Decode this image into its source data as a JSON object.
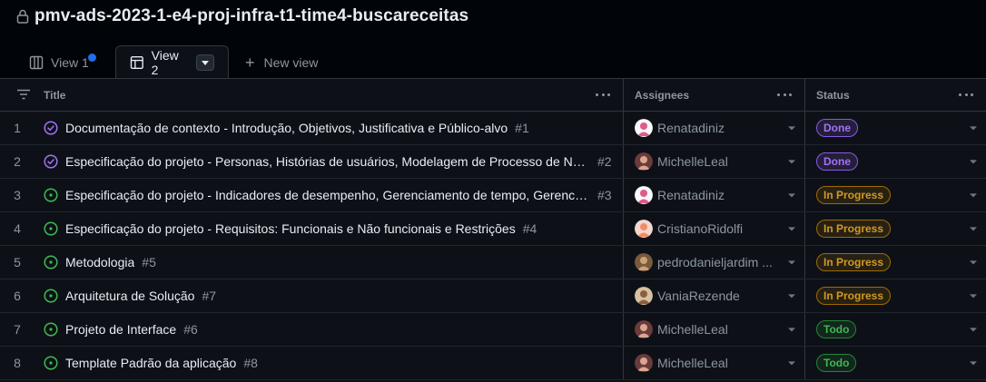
{
  "project": {
    "title": "pmv-ads-2023-1-e4-proj-infra-t1-time4-buscareceitas"
  },
  "tabs": [
    {
      "label": "View 1"
    },
    {
      "label": "View 2"
    },
    {
      "label": "New view"
    }
  ],
  "columns": {
    "title": "Title",
    "assignees": "Assignees",
    "status": "Status"
  },
  "colors": {
    "done": "#a371f7",
    "in_progress": "#d29922",
    "todo": "#3fb950",
    "unread_dot": "#1f6feb"
  },
  "rows": [
    {
      "index": "1",
      "title": "Documentação de contexto - Introdução, Objetivos, Justificativa e Público-alvo",
      "issue": "#1",
      "state_icon": "closed-issue-icon",
      "assignee": "Renatadiniz",
      "status": "Done"
    },
    {
      "index": "2",
      "title": "Especificação do projeto - Personas, Histórias de usuários, Modelagem de Processo de Neg...",
      "issue": "#2",
      "state_icon": "closed-issue-icon",
      "assignee": "MichelleLeal",
      "status": "Done"
    },
    {
      "index": "3",
      "title": "Especificação do projeto - Indicadores de desempenho, Gerenciamento de tempo, Gerencia...",
      "issue": "#3",
      "state_icon": "open-issue-icon",
      "assignee": "Renatadiniz",
      "status": "In Progress"
    },
    {
      "index": "4",
      "title": "Especificação do projeto - Requisitos: Funcionais e Não funcionais e Restrições",
      "issue": "#4",
      "state_icon": "open-issue-icon",
      "assignee": "CristianoRidolfi",
      "status": "In Progress"
    },
    {
      "index": "5",
      "title": "Metodologia",
      "issue": "#5",
      "state_icon": "open-issue-icon",
      "assignee": "pedrodanieljardim ...",
      "status": "In Progress"
    },
    {
      "index": "6",
      "title": "Arquitetura de Solução",
      "issue": "#7",
      "state_icon": "open-issue-icon",
      "assignee": "VaniaRezende",
      "status": "In Progress"
    },
    {
      "index": "7",
      "title": "Projeto de Interface",
      "issue": "#6",
      "state_icon": "open-issue-icon",
      "assignee": "MichelleLeal",
      "status": "Todo"
    },
    {
      "index": "8",
      "title": "Template Padrão da aplicação",
      "issue": "#8",
      "state_icon": "open-issue-icon",
      "assignee": "MichelleLeal",
      "status": "Todo"
    }
  ]
}
